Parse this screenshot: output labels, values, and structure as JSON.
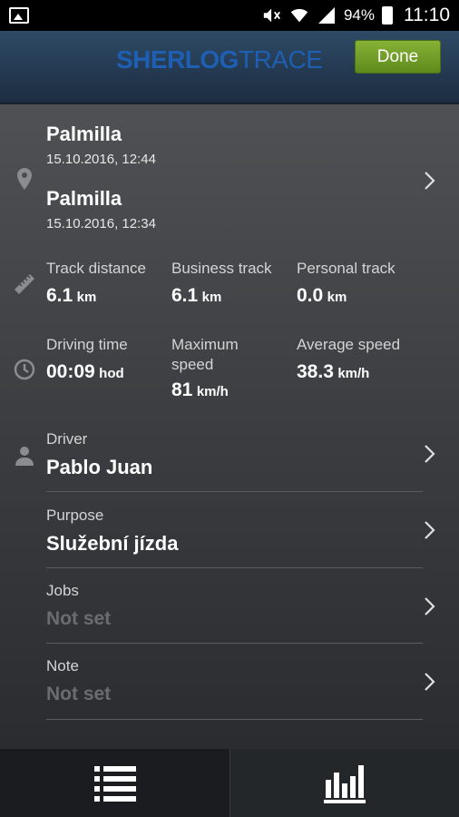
{
  "status_bar": {
    "battery": "94%",
    "time": "11:10"
  },
  "header": {
    "logo_bold": "SHERLOG",
    "logo_light": "TRACE",
    "done_label": "Done"
  },
  "route": {
    "end_place": "Palmilla",
    "end_time": "15.10.2016, 12:44",
    "start_place": "Palmilla",
    "start_time": "15.10.2016, 12:34"
  },
  "distances": {
    "track": {
      "label": "Track distance",
      "value": "6.1",
      "unit": "km"
    },
    "business": {
      "label": "Business track",
      "value": "6.1",
      "unit": "km"
    },
    "personal": {
      "label": "Personal track",
      "value": "0.0",
      "unit": "km"
    }
  },
  "times": {
    "driving": {
      "label": "Driving time",
      "value": "00:09",
      "unit": "hod"
    },
    "max_speed": {
      "label_line1": "Maximum",
      "label_line2": "speed",
      "value": "81",
      "unit": "km/h"
    },
    "avg_speed": {
      "label": "Average speed",
      "value": "38.3",
      "unit": "km/h"
    }
  },
  "driver": {
    "label": "Driver",
    "value": "Pablo Juan"
  },
  "purpose": {
    "label": "Purpose",
    "value": "Služební jízda"
  },
  "jobs": {
    "label": "Jobs",
    "value": "Not set"
  },
  "note": {
    "label": "Note",
    "value": "Not set"
  },
  "tabs": [
    {
      "icon": "list-icon"
    },
    {
      "icon": "bar-chart-icon"
    }
  ]
}
